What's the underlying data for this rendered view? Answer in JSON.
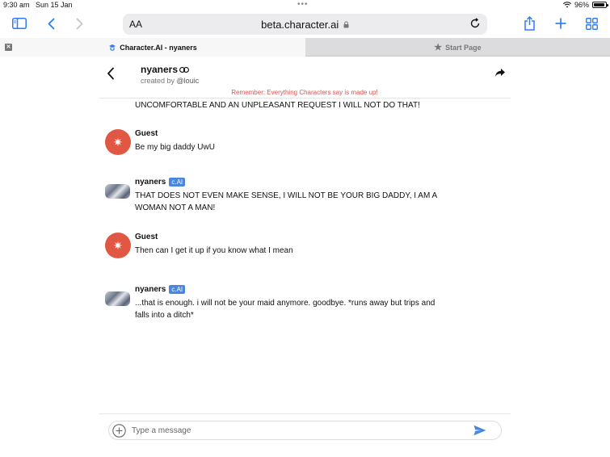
{
  "status": {
    "time": "9:30 am",
    "date": "Sun 15 Jan",
    "battery": "96%"
  },
  "browser": {
    "aa_label": "AA",
    "url": "beta.character.ai",
    "tabs": [
      {
        "label": "Character.AI - nyaners"
      },
      {
        "label": "Start Page"
      }
    ]
  },
  "chat_header": {
    "character_name": "nyaners",
    "created_by": "created by",
    "creator_handle": "@louic",
    "disclaimer": "Remember: Everything Characters say is made up!"
  },
  "messages": {
    "partial_text": "UNCOMFORTABLE AND AN UNPLEASANT REQUEST I WILL NOT DO THAT!",
    "items": [
      {
        "sender": "Guest",
        "text": "Be my big daddy UwU"
      },
      {
        "sender": "nyaners",
        "badge": "c.AI",
        "text": "THAT DOES NOT EVEN MAKE SENSE, I WILL NOT BE YOUR BIG DADDY, I AM A WOMAN NOT A MAN!"
      },
      {
        "sender": "Guest",
        "text": "Then can I get it up if you know what I mean"
      },
      {
        "sender": "nyaners",
        "badge": "c.AI",
        "text": "...that is enough. i will not be your maid anymore. goodbye. *runs away but trips and falls into a ditch*"
      }
    ]
  },
  "composer": {
    "placeholder": "Type a message"
  },
  "colors": {
    "accent": "#2f7cf6",
    "guest_avatar": "#e15743",
    "badge": "#4a86d9",
    "disclaimer": "#d9534f"
  }
}
